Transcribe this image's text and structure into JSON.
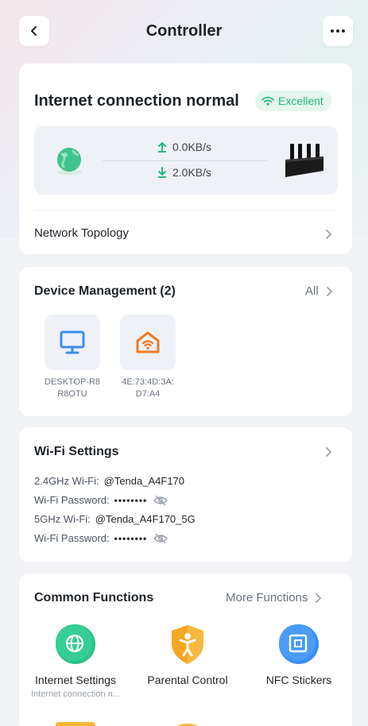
{
  "header": {
    "title": "Controller"
  },
  "status": {
    "title": "Internet connection normal",
    "quality": "Excellent",
    "upload_speed": "0.0KB/s",
    "download_speed": "2.0KB/s",
    "topology_label": "Network Topology"
  },
  "devices": {
    "title": "Device Management (2)",
    "all_label": "All",
    "items": [
      {
        "name": "DESKTOP-R8R8OTU",
        "icon": "monitor-icon"
      },
      {
        "name": "4E:73:4D:3A:D7:A4",
        "icon": "smart-home-icon"
      }
    ]
  },
  "wifi": {
    "title": "Wi-Fi Settings",
    "rows": [
      {
        "label": "2.4GHz Wi-Fi:",
        "value": "@Tenda_A4F170"
      },
      {
        "label": "Wi-Fi Password:",
        "value": "••••••••"
      },
      {
        "label": "5GHz Wi-Fi:",
        "value": "@Tenda_A4F170_5G"
      },
      {
        "label": "Wi-Fi Password:",
        "value": "••••••••"
      }
    ]
  },
  "functions": {
    "title": "Common Functions",
    "more_label": "More Functions",
    "items": [
      {
        "label": "Internet Settings",
        "sub": "Internet connection n...",
        "icon": "globe-icon",
        "color": "#2cc28a"
      },
      {
        "label": "Parental Control",
        "sub": "",
        "icon": "parental-icon",
        "color": "#f5a623"
      },
      {
        "label": "NFC Stickers",
        "sub": "",
        "icon": "nfc-icon",
        "color": "#3a8ef0"
      }
    ]
  },
  "colors": {
    "accent_green": "#27b87a",
    "blue": "#3a8ef0",
    "orange": "#f07a22"
  }
}
